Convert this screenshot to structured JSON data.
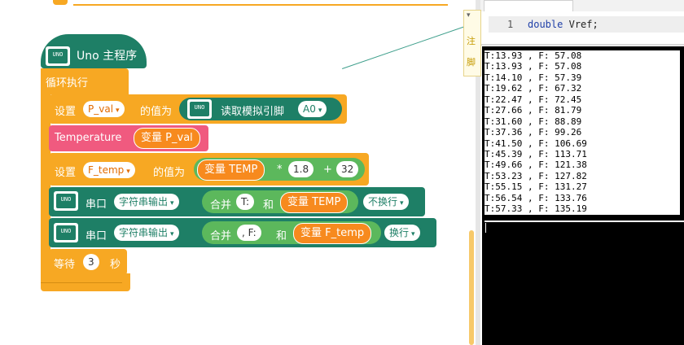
{
  "blocks": {
    "hat_label": "Uno 主程序",
    "uno_icon_text": "UNO",
    "loop_label": "循环执行",
    "set1": {
      "set_label": "设置",
      "var": "P_val",
      "assign": "的值为",
      "func": "读取模拟引脚",
      "pin": "A0"
    },
    "temperature": {
      "label": "Temperature",
      "var_prefix": "变量",
      "var": "P_val"
    },
    "set2": {
      "set_label": "设置",
      "var": "F_temp",
      "assign": "的值为",
      "var_prefix": "变量",
      "var_ref": "TEMP",
      "op_mul": "*",
      "factor": "1.8",
      "op_add": "+",
      "offset": "32"
    },
    "serial1": {
      "label": "串口",
      "mode": "字符串输出",
      "join": "合并",
      "text": "T:",
      "and": "和",
      "var_prefix": "变量",
      "var": "TEMP",
      "newline": "不换行"
    },
    "serial2": {
      "label": "串口",
      "mode": "字符串输出",
      "join": "合并",
      "text": ", F:",
      "and": "和",
      "var_prefix": "变量",
      "var": "F_temp",
      "newline": "换行"
    },
    "wait": {
      "label": "等待",
      "value": "3",
      "unit": "秒"
    }
  },
  "code": {
    "line_number": "1",
    "keyword": "double",
    "identifier": "Vref;"
  },
  "side": {
    "t1": "注",
    "t2": "脚"
  },
  "serial_output": [
    "T:13.93 , F: 57.08",
    "T:13.93 , F: 57.08",
    "T:14.10 , F: 57.39",
    "T:19.62 , F: 67.32",
    "T:22.47 , F: 72.45",
    "T:27.66 , F: 81.79",
    "T:31.60 , F: 88.89",
    "T:37.36 , F: 99.26",
    "T:41.50 , F: 106.69",
    "T:45.39 , F: 113.71",
    "T:49.66 , F: 121.38",
    "T:53.23 , F: 127.82",
    "T:55.15 , F: 131.27",
    "T:56.54 , F: 133.76",
    "T:57.33 , F: 135.19"
  ],
  "colors": {
    "control": "#f7a823",
    "board": "#1e7f66",
    "text_block": "#f05a7f",
    "math": "#5cb85c",
    "variable": "#f78a1e"
  }
}
